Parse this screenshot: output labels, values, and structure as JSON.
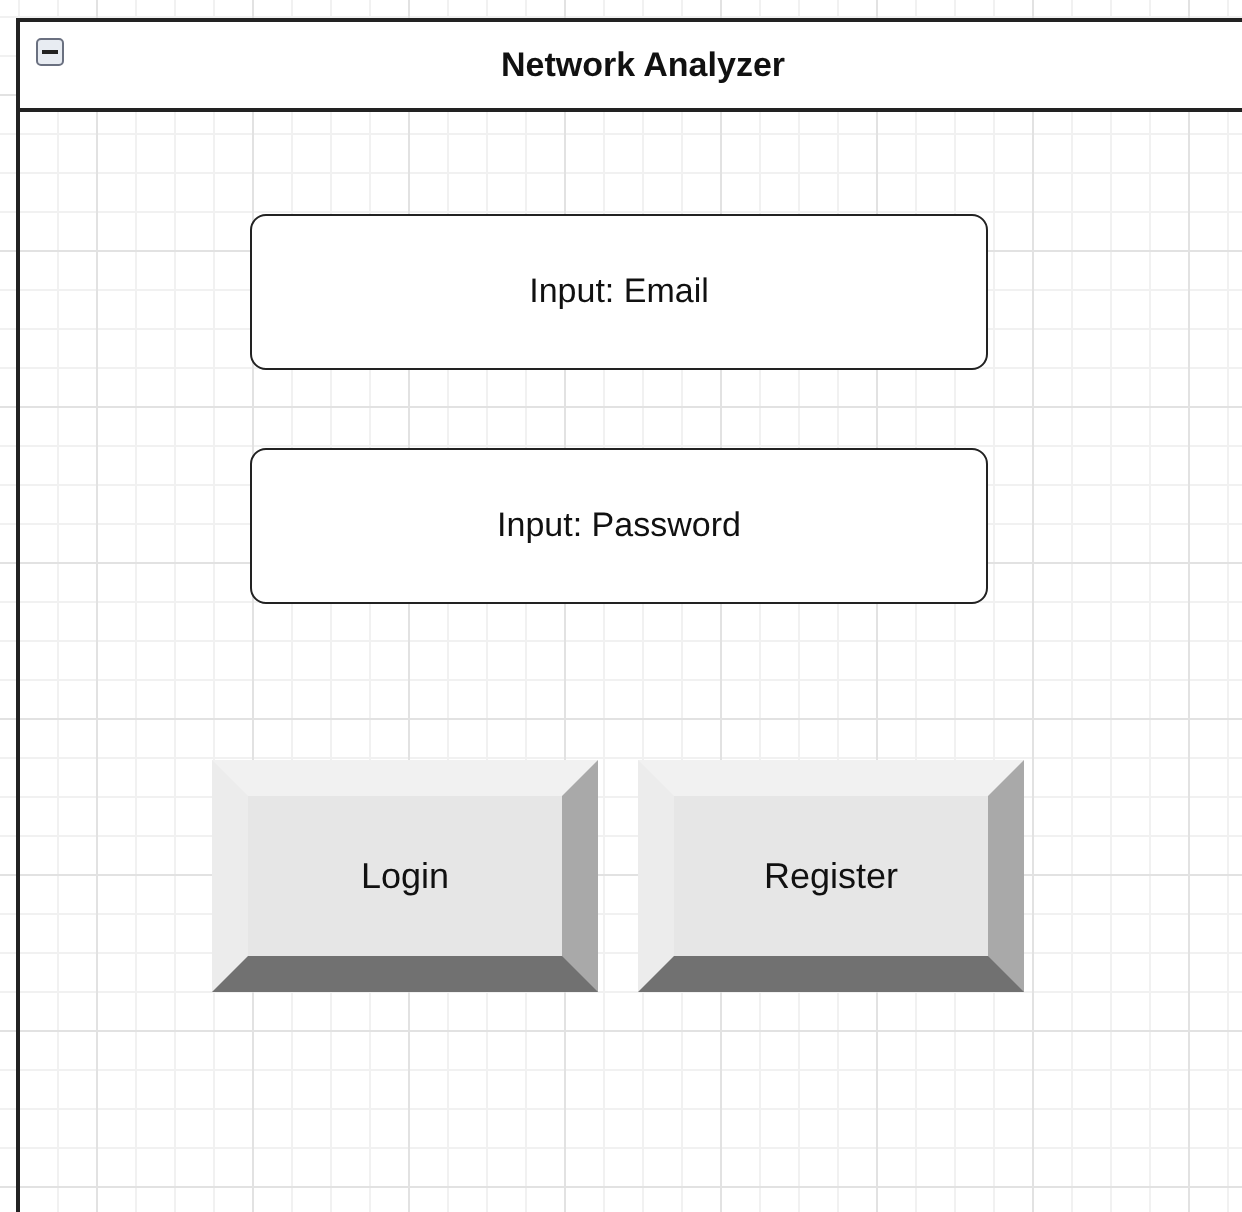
{
  "window": {
    "title": "Network Analyzer",
    "expanded": true
  },
  "fields": [
    {
      "label": "Input: Email"
    },
    {
      "label": "Input: Password"
    }
  ],
  "buttons": [
    "Login",
    "Register"
  ]
}
